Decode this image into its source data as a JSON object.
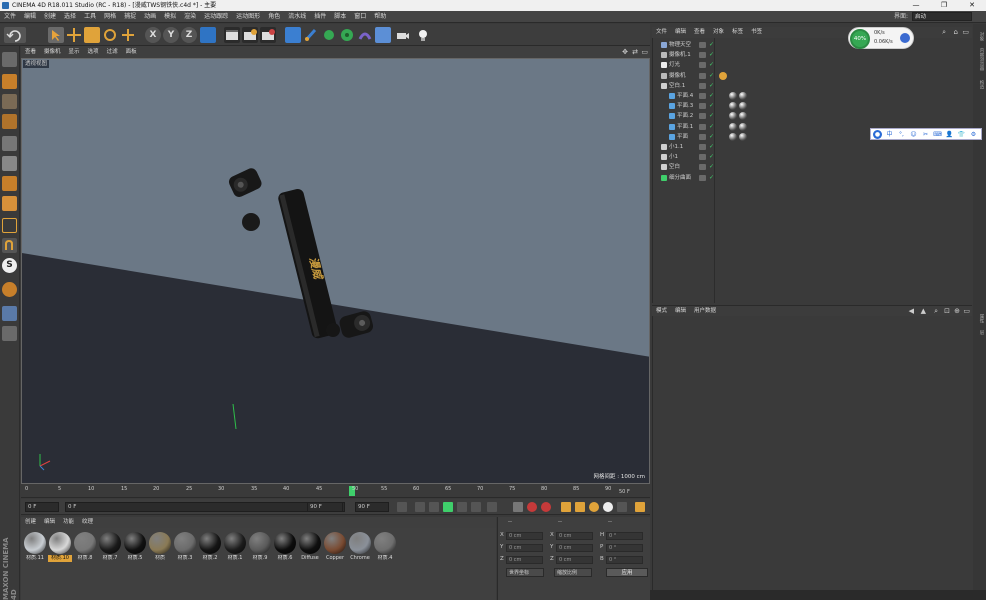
{
  "window": {
    "title": "CINEMA 4D R18.011 Studio (RC - R18) - [漫威TWS钢铁侠.c4d *] - 主要",
    "min": "—",
    "restore": "❐",
    "close": "✕"
  },
  "menubar": {
    "items": [
      "文件",
      "编辑",
      "创建",
      "选择",
      "工具",
      "网格",
      "捕捉",
      "动画",
      "模拟",
      "渲染",
      "运动跟踪",
      "运动图形",
      "角色",
      "流水线",
      "插件",
      "脚本",
      "窗口",
      "帮助"
    ],
    "layout_label": "界面:",
    "layout_value": "启动"
  },
  "viewport": {
    "menu": [
      "查看",
      "摄像机",
      "显示",
      "选项",
      "过滤",
      "面板"
    ],
    "label": "透视视图",
    "grid_info": "网格间距 : 1000 cm",
    "product_text": "漫威"
  },
  "timeline": {
    "ticks": [
      "0",
      "5",
      "10",
      "15",
      "20",
      "25",
      "30",
      "35",
      "40",
      "45",
      "50",
      "55",
      "60",
      "65",
      "70",
      "75",
      "80",
      "85",
      "90"
    ],
    "end_label": "50 F",
    "field_start": "0 F",
    "field_min": "0 F",
    "field_max": "90 F",
    "field_end": "90 F"
  },
  "materials": {
    "menu": [
      "创建",
      "编辑",
      "功能",
      "纹理"
    ],
    "items": [
      {
        "name": "材质.11",
        "color": "#c9ced3"
      },
      {
        "name": "材质.10",
        "color": "#d8d8d8",
        "selected": true
      },
      {
        "name": "材质.8",
        "color": "#777777"
      },
      {
        "name": "材质.7",
        "color": "#1a1a1a"
      },
      {
        "name": "材质.5",
        "color": "#111111"
      },
      {
        "name": "材质",
        "color": "#8a7a55"
      },
      {
        "name": "材质.3",
        "color": "#6b6b6b"
      },
      {
        "name": "材质.2",
        "color": "#151515"
      },
      {
        "name": "材质.1",
        "color": "#1c1c1c"
      },
      {
        "name": "材质.9",
        "color": "#5a5a5a"
      },
      {
        "name": "材质.6",
        "color": "#0c0c0c"
      },
      {
        "name": "Diffuse",
        "color": "#0f0f0f"
      },
      {
        "name": "Copper",
        "color": "#7a4b32"
      },
      {
        "name": "Chrome",
        "color": "#8a9099"
      },
      {
        "name": "材质.4",
        "color": "#6e6e6e"
      }
    ]
  },
  "coordinates": {
    "header": [
      "--",
      "--",
      "--"
    ],
    "rows": [
      {
        "a": "X",
        "av": "0 cm",
        "b": "X",
        "bv": "0 cm",
        "c": "H",
        "cv": "0 °"
      },
      {
        "a": "Y",
        "av": "0 cm",
        "b": "Y",
        "bv": "0 cm",
        "c": "P",
        "cv": "0 °"
      },
      {
        "a": "Z",
        "av": "0 cm",
        "b": "Z",
        "bv": "0 cm",
        "c": "B",
        "cv": "0 °"
      }
    ],
    "dropdown1": "世界坐标",
    "dropdown2": "缩放比例",
    "apply": "应用"
  },
  "object_manager": {
    "menu": [
      "文件",
      "编辑",
      "查看",
      "对象",
      "标签",
      "书签"
    ],
    "objects": [
      {
        "name": "物理天空",
        "indent": 0,
        "icon": "#8aa7d6"
      },
      {
        "name": "摄像机.1",
        "indent": 0,
        "icon": "#bbbbbb"
      },
      {
        "name": "灯光",
        "indent": 0,
        "icon": "#eeeeee"
      },
      {
        "name": "摄像机",
        "indent": 0,
        "icon": "#bbbbbb"
      },
      {
        "name": "空白.1",
        "indent": 0,
        "icon": "#cfcfcf"
      },
      {
        "name": "平面.4",
        "indent": 1,
        "icon": "#5aa3e0"
      },
      {
        "name": "平面.3",
        "indent": 1,
        "icon": "#5aa3e0"
      },
      {
        "name": "平面.2",
        "indent": 1,
        "icon": "#5aa3e0"
      },
      {
        "name": "平面.1",
        "indent": 1,
        "icon": "#5aa3e0"
      },
      {
        "name": "平面",
        "indent": 1,
        "icon": "#5aa3e0"
      },
      {
        "name": "小1.1",
        "indent": 0,
        "icon": "#cfcfcf"
      },
      {
        "name": "小1",
        "indent": 0,
        "icon": "#cfcfcf"
      },
      {
        "name": "空白",
        "indent": 0,
        "icon": "#cfcfcf"
      },
      {
        "name": "细分曲面",
        "indent": 0,
        "icon": "#3fcf6b"
      }
    ]
  },
  "attribute_manager": {
    "menu": [
      "模式",
      "编辑",
      "用户数据"
    ]
  },
  "right_tabs": [
    "对象",
    "内容浏览器",
    "构造",
    "属性",
    "层"
  ],
  "net_widget": {
    "percent": "40%",
    "up": "0K/s",
    "down": "0.06K/s"
  },
  "ime": [
    "中",
    "°,",
    "☺",
    "✂",
    "⌨",
    "👤",
    "👕",
    "⚙"
  ],
  "watermark": "MAXON CINEMA 4D",
  "colors": {
    "accent_orange": "#e0a33a",
    "play_green": "#3fcf6b",
    "viewport_bg": "#4a535e"
  }
}
